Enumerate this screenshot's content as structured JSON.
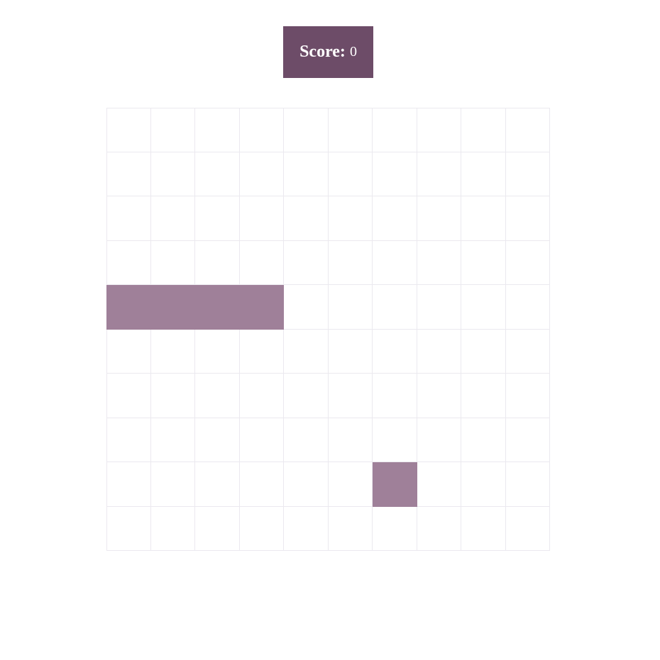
{
  "score": {
    "label": "Score:",
    "value": "0"
  },
  "board": {
    "rows": 10,
    "cols": 10,
    "snake": [
      [
        4,
        0
      ],
      [
        4,
        1
      ],
      [
        4,
        2
      ],
      [
        4,
        3
      ]
    ],
    "food": [
      8,
      6
    ]
  },
  "colors": {
    "score_bg": "#6d4c68",
    "snake": "#9f8099",
    "food": "#9f8099",
    "grid_line": "#ebe9ef"
  }
}
